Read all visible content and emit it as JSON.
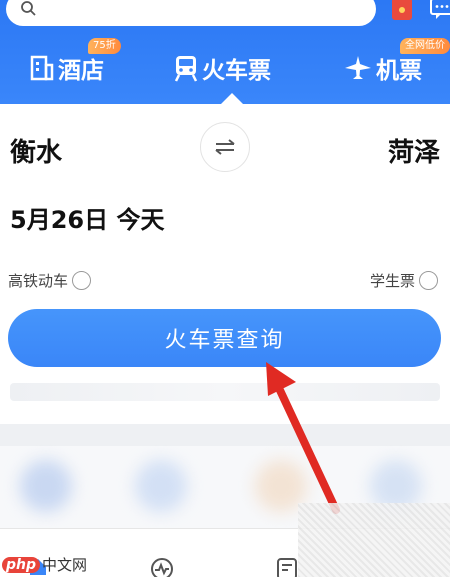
{
  "header": {
    "tabs": [
      {
        "label": "酒店",
        "badge": "75折"
      },
      {
        "label": "火车票"
      },
      {
        "label": "机票",
        "badge": "全网低价"
      }
    ]
  },
  "route": {
    "from_city": "衡水",
    "to_city": "菏泽"
  },
  "date": {
    "text": "5月26日 今天"
  },
  "options": {
    "gaotie_label": "高铁动车",
    "student_label": "学生票"
  },
  "query_button": {
    "label": "火车票查询"
  },
  "watermark": {
    "php": "php",
    "site": "中文网"
  },
  "colors": {
    "primary": "#3a86f8",
    "header": "#2c78f4",
    "badge": "#ff8a3d",
    "arrow": "#e02a23"
  }
}
